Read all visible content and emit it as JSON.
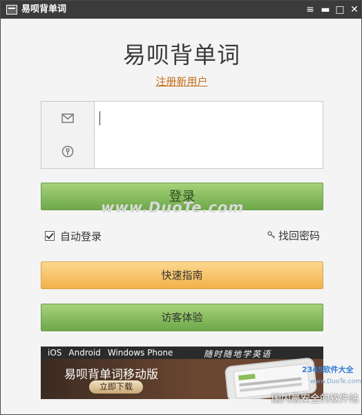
{
  "window": {
    "title": "易呗背单词",
    "controls": {
      "menu": "≡",
      "minimize": "▬",
      "maximize": "□",
      "close": "✕"
    }
  },
  "brand": "易呗背单词",
  "register_link": "注册新用户",
  "form": {
    "email_icon": "mail-icon",
    "email_value": "",
    "password_icon": "key-icon",
    "password_value": ""
  },
  "buttons": {
    "login": "登录",
    "guide": "快速指南",
    "guest": "访客体验"
  },
  "options": {
    "auto_login": "自动登录",
    "auto_login_checked": true,
    "recover_password": "找回密码"
  },
  "watermark": "www.DuoTe.com",
  "banner": {
    "platforms": [
      "iOS",
      "Android",
      "Windows Phone"
    ],
    "slogan": "随时随地学英语",
    "title": "易呗背单词移动版",
    "download": "立即下载"
  },
  "corner": {
    "logo": "2345软件大全",
    "sub": "www.DuoTe.com",
    "text": "国内最安全的软件站"
  },
  "colors": {
    "titlebar": "#3b3b3b",
    "link": "#c46b18",
    "green": "#7fb556",
    "orange": "#f5bf5f"
  }
}
